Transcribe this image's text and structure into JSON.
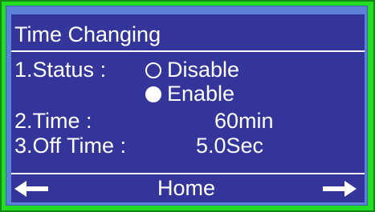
{
  "screen": {
    "title": "Time Changing",
    "status": {
      "label": "1.Status :",
      "options": [
        {
          "label": "Disable",
          "selected": false
        },
        {
          "label": "Enable",
          "selected": true
        }
      ]
    },
    "time": {
      "label": "2.Time :",
      "value": "60min"
    },
    "off_time": {
      "label": "3.Off Time :",
      "value": "5.0Sec"
    },
    "footer": {
      "back_icon": "arrow-left-icon",
      "home_label": "Home",
      "forward_icon": "arrow-right-icon"
    }
  },
  "colors": {
    "bezel": "#22dd22",
    "frame": "#5b82d6",
    "screen_bg": "#33359a",
    "text": "#ffffff"
  }
}
